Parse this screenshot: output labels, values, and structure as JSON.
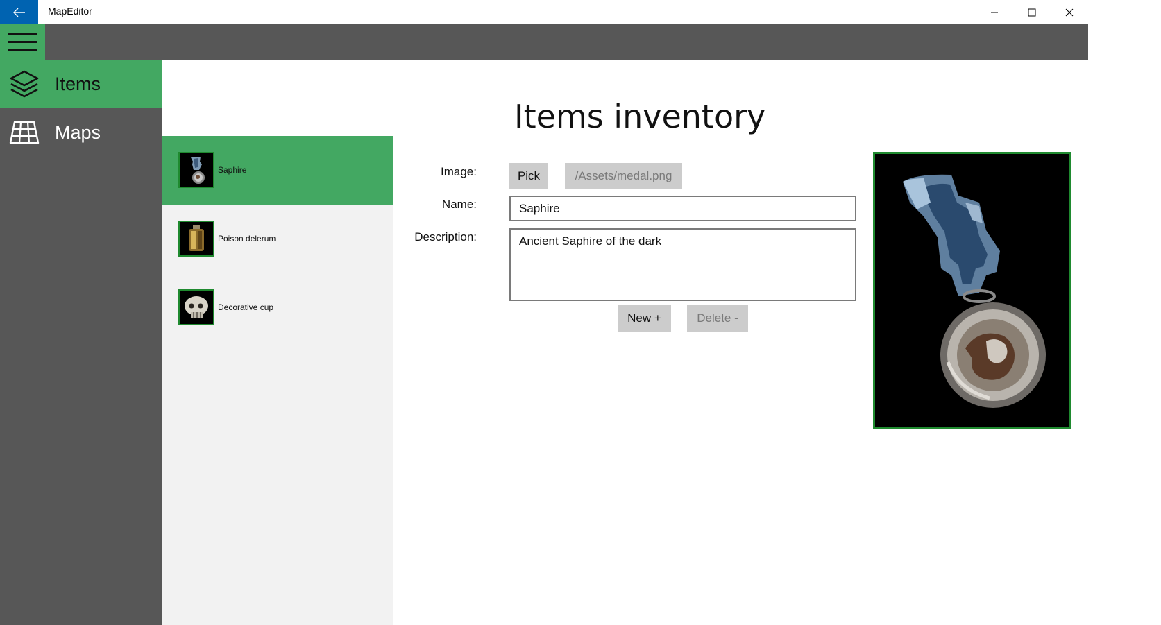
{
  "window": {
    "title": "MapEditor",
    "accent_color": "#0063b1"
  },
  "nav": {
    "items": [
      {
        "label": "Items",
        "icon": "layers-icon",
        "active": true
      },
      {
        "label": "Maps",
        "icon": "grid-map-icon",
        "active": false
      }
    ],
    "accent_color": "#43a862"
  },
  "item_list": [
    {
      "name": "Saphire",
      "icon": "medal-icon",
      "selected": true
    },
    {
      "name": "Poison delerum",
      "icon": "flask-icon",
      "selected": false
    },
    {
      "name": "Decorative cup",
      "icon": "skull-cup-icon",
      "selected": false
    }
  ],
  "main": {
    "title": "Items inventory",
    "form": {
      "image_label": "Image:",
      "pick_label": "Pick",
      "image_path": "/Assets/medal.png",
      "name_label": "Name:",
      "name_value": "Saphire",
      "description_label": "Description:",
      "description_value": "Ancient Saphire of the dark",
      "new_label": "New +",
      "delete_label": "Delete -"
    },
    "preview_icon": "medal-icon"
  }
}
